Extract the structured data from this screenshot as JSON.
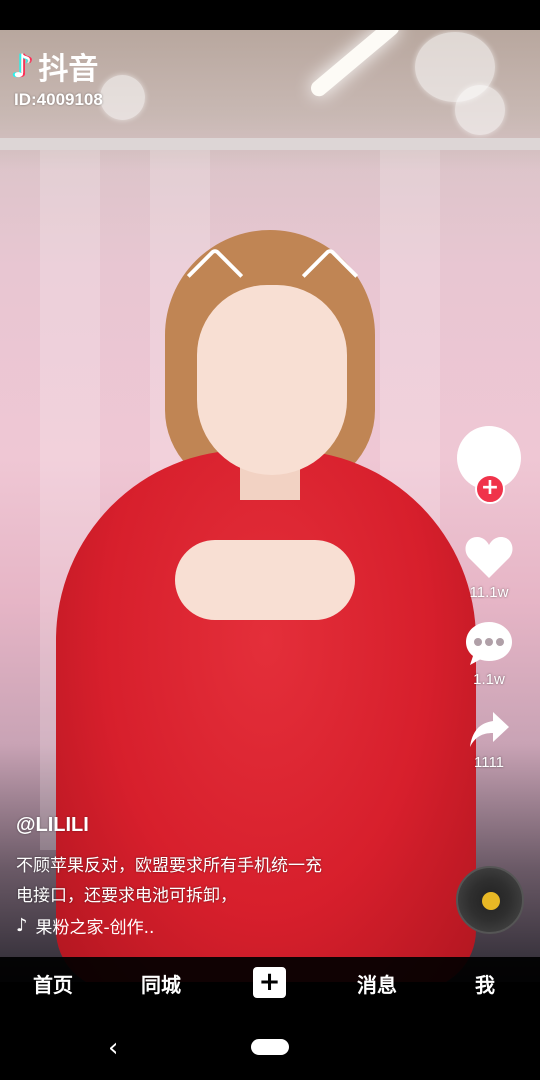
{
  "app": {
    "logo_glyph": "♪",
    "name": "抖音",
    "id_text": "ID:4009108"
  },
  "actions": {
    "follow_glyph": "+",
    "like_count": "11.1w",
    "comment_count": "1.1w",
    "share_count": "1111"
  },
  "caption": {
    "username": "@LILILI",
    "line1": "不顾苹果反对，欧盟要求所有手机统一充",
    "line2": "电接口，还要求电池可拆卸，",
    "music_glyph": "♪",
    "music": "果粉之家-创作.."
  },
  "nav": {
    "home": "首页",
    "nearby": "同城",
    "create": "+",
    "messages": "消息",
    "me": "我"
  },
  "system_nav": {
    "back_glyph": "‹"
  },
  "colors": {
    "accent_red": "#f0334a",
    "disc_center": "#e8b825",
    "shirt": "#d71f2c"
  }
}
